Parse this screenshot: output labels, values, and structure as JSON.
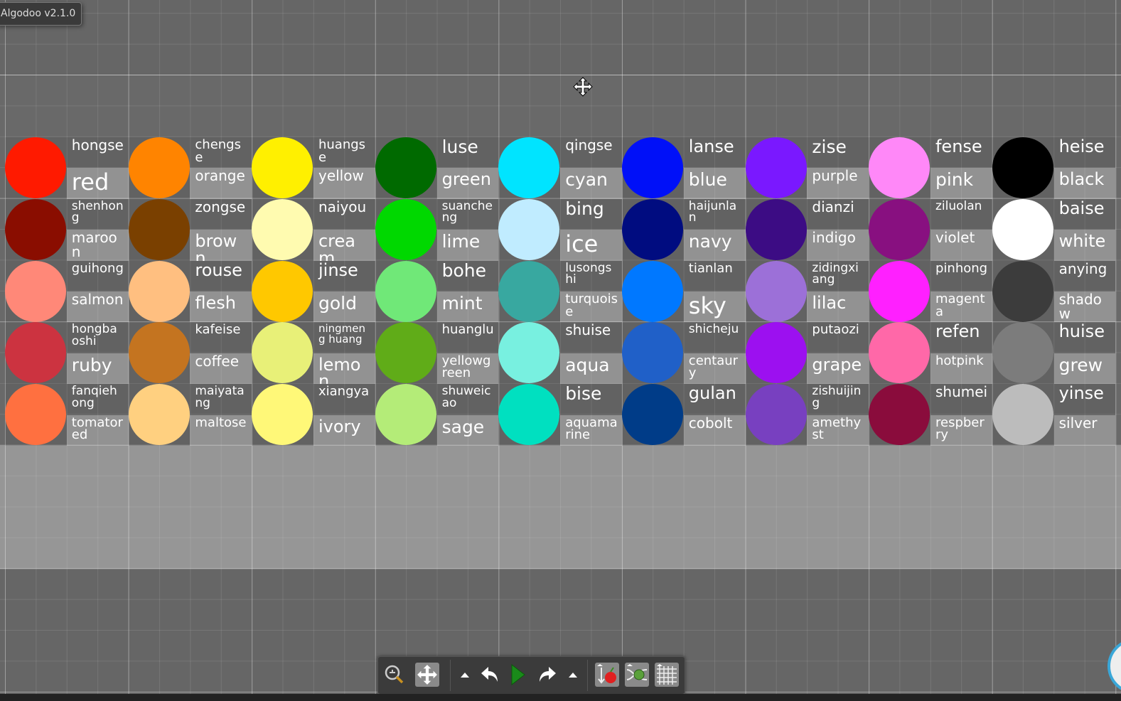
{
  "window": {
    "title": "Algodoo v2.1.0"
  },
  "palette": {
    "columns": [
      [
        {
          "pinyin": "hongse",
          "english": "red",
          "color": "#ff1a00"
        },
        {
          "pinyin": "shenhong",
          "english": "maroon",
          "color": "#8a0d00"
        },
        {
          "pinyin": "guihong",
          "english": "salmon",
          "color": "#ff8878"
        },
        {
          "pinyin": "hongbaoshi",
          "english": "ruby",
          "color": "#cc3340"
        },
        {
          "pinyin": "fanqiehong",
          "english": "tomatored",
          "color": "#ff7040"
        }
      ],
      [
        {
          "pinyin": "chengse",
          "english": "orange",
          "color": "#ff8400"
        },
        {
          "pinyin": "zongse",
          "english": "brown",
          "color": "#7a4000"
        },
        {
          "pinyin": "rouse",
          "english": "flesh",
          "color": "#ffbf80"
        },
        {
          "pinyin": "kafeise",
          "english": "coffee",
          "color": "#c47420"
        },
        {
          "pinyin": "maiyatang",
          "english": "maltose",
          "color": "#ffd080"
        }
      ],
      [
        {
          "pinyin": "huangse",
          "english": "yellow",
          "color": "#fff000"
        },
        {
          "pinyin": "naiyou",
          "english": "cream",
          "color": "#fffbb0"
        },
        {
          "pinyin": "jinse",
          "english": "gold",
          "color": "#ffc800"
        },
        {
          "pinyin": "ningmeng huang",
          "english": "lemon",
          "color": "#e8f078"
        },
        {
          "pinyin": "xiangya",
          "english": "ivory",
          "color": "#fff878"
        }
      ],
      [
        {
          "pinyin": "luse",
          "english": "green",
          "color": "#006a00"
        },
        {
          "pinyin": "suancheng",
          "english": "lime",
          "color": "#00d800"
        },
        {
          "pinyin": "bohe",
          "english": "mint",
          "color": "#70e878"
        },
        {
          "pinyin": "huanglu",
          "english": "yellowgreen",
          "color": "#60ac18"
        },
        {
          "pinyin": "shuweicao",
          "english": "sage",
          "color": "#b4ec78"
        }
      ],
      [
        {
          "pinyin": "qingse",
          "english": "cyan",
          "color": "#00e4ff"
        },
        {
          "pinyin": "bing",
          "english": "ice",
          "color": "#c0ecff"
        },
        {
          "pinyin": "lusongshi",
          "english": "turquoise",
          "color": "#38a8a0"
        },
        {
          "pinyin": "shuise",
          "english": "aqua",
          "color": "#78f0e0"
        },
        {
          "pinyin": "bise",
          "english": "aquamarine",
          "color": "#00e0c0"
        }
      ],
      [
        {
          "pinyin": "lanse",
          "english": "blue",
          "color": "#0010f8"
        },
        {
          "pinyin": "haijunlan",
          "english": "navy",
          "color": "#000c80"
        },
        {
          "pinyin": "tianlan",
          "english": "sky",
          "color": "#0078ff"
        },
        {
          "pinyin": "shicheju",
          "english": "centaury",
          "color": "#2060c8"
        },
        {
          "pinyin": "gulan",
          "english": "cobolt",
          "color": "#003c88"
        }
      ],
      [
        {
          "pinyin": "zise",
          "english": "purple",
          "color": "#7a18ff"
        },
        {
          "pinyin": "dianzi",
          "english": "indigo",
          "color": "#3c0c84"
        },
        {
          "pinyin": "zidingxiang",
          "english": "lilac",
          "color": "#9c70d8"
        },
        {
          "pinyin": "putaozi",
          "english": "grape",
          "color": "#9c10f0"
        },
        {
          "pinyin": "zishuijing",
          "english": "amethyst",
          "color": "#7840c0"
        }
      ],
      [
        {
          "pinyin": "fense",
          "english": "pink",
          "color": "#ff88f8"
        },
        {
          "pinyin": "ziluolan",
          "english": "violet",
          "color": "#881080"
        },
        {
          "pinyin": "pinhong",
          "english": "magenta",
          "color": "#ff20ff"
        },
        {
          "pinyin": "refen",
          "english": "hotpink",
          "color": "#ff68a8"
        },
        {
          "pinyin": "shumei",
          "english": "respberry",
          "color": "#8a0c3c"
        }
      ],
      [
        {
          "pinyin": "heise",
          "english": "black",
          "color": "#000000"
        },
        {
          "pinyin": "baise",
          "english": "white",
          "color": "#ffffff"
        },
        {
          "pinyin": "anying",
          "english": "shadow",
          "color": "#3c3c3c"
        },
        {
          "pinyin": "huise",
          "english": "grew",
          "color": "#7c7c7c"
        },
        {
          "pinyin": "yinse",
          "english": "silver",
          "color": "#bcbcbc"
        }
      ]
    ]
  },
  "toolbar": {
    "items": [
      "zoom-icon",
      "move-icon",
      "undo-options-icon",
      "undo-icon",
      "play-icon",
      "redo-icon",
      "redo-options-icon",
      "gravity-icon",
      "air-friction-icon",
      "grid-icon"
    ],
    "play_color": "#1a8a1a"
  }
}
